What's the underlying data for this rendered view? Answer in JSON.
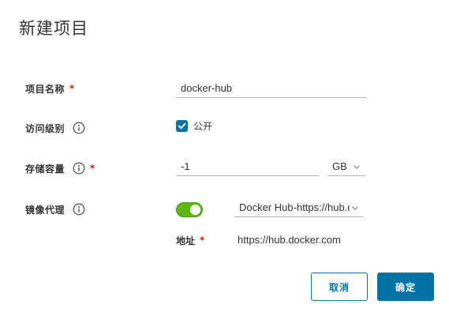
{
  "dialog": {
    "title": "新建项目"
  },
  "form": {
    "project_name": {
      "label": "项目名称",
      "required_mark": "*",
      "value": "docker-hub"
    },
    "access_level": {
      "label": "访问级别",
      "info_icon": "info-icon",
      "checkbox_label": "公开",
      "checked": true
    },
    "storage_capacity": {
      "label": "存储容量",
      "info_icon": "info-icon",
      "required_mark": "*",
      "value": "-1",
      "unit": "GB"
    },
    "mirror_proxy": {
      "label": "镜像代理",
      "info_icon": "info-icon",
      "enabled": true,
      "registry": "Docker Hub-https://hub.docker.com"
    },
    "address": {
      "label": "地址",
      "required_mark": "*",
      "value": "https://hub.docker.com"
    }
  },
  "footer": {
    "cancel_label": "取消",
    "confirm_label": "确定"
  },
  "colors": {
    "primary": "#0072a3",
    "toggle_on": "#5eb715",
    "required": "#c92100"
  }
}
